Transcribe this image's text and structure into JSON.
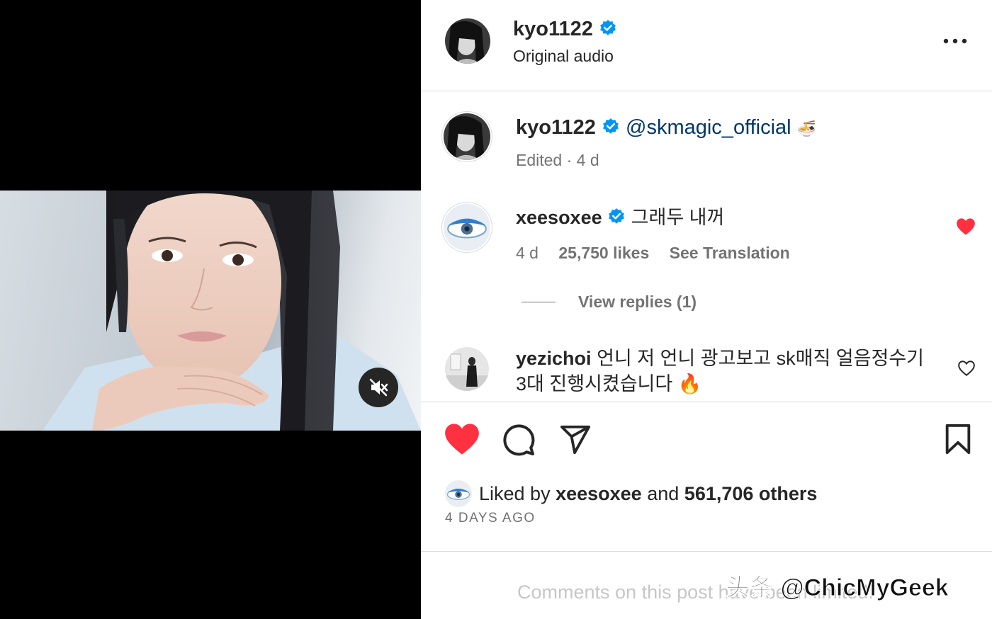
{
  "header": {
    "username": "kyo1122",
    "audio": "Original audio"
  },
  "caption": {
    "username": "kyo1122",
    "mention": "@skmagic_official",
    "emoji": "🍜",
    "meta": "Edited · 4 d"
  },
  "comments": [
    {
      "username": "xeesoxee",
      "text": "그래두 내꺼",
      "age": "4 d",
      "likes": "25,750 likes",
      "translate": "See Translation",
      "view_replies": "View replies (1)",
      "liked": true
    },
    {
      "username": "yezichoi",
      "text_line1": "언니 저 언니 광고보고 sk매직 얼음정수기",
      "text_line2": "3대 진행시켰습니다 🔥",
      "liked": false
    }
  ],
  "likes_summary": {
    "prefix": "Liked by",
    "user": "xeesoxee",
    "middle": "and",
    "others": "561,706 others"
  },
  "post_date": "4 DAYS AGO",
  "comments_notice": "Comments on this post have been limited.",
  "watermark": "头条 @ChicMyGeek",
  "colors": {
    "like_red": "#ff3040",
    "verified_blue": "#0095f6",
    "mention_blue": "#00376b",
    "secondary_text": "#737373"
  },
  "icons": [
    "mute-icon",
    "verified-icon",
    "more-options-icon",
    "heart-icon",
    "comment-icon",
    "share-icon",
    "bookmark-icon"
  ]
}
